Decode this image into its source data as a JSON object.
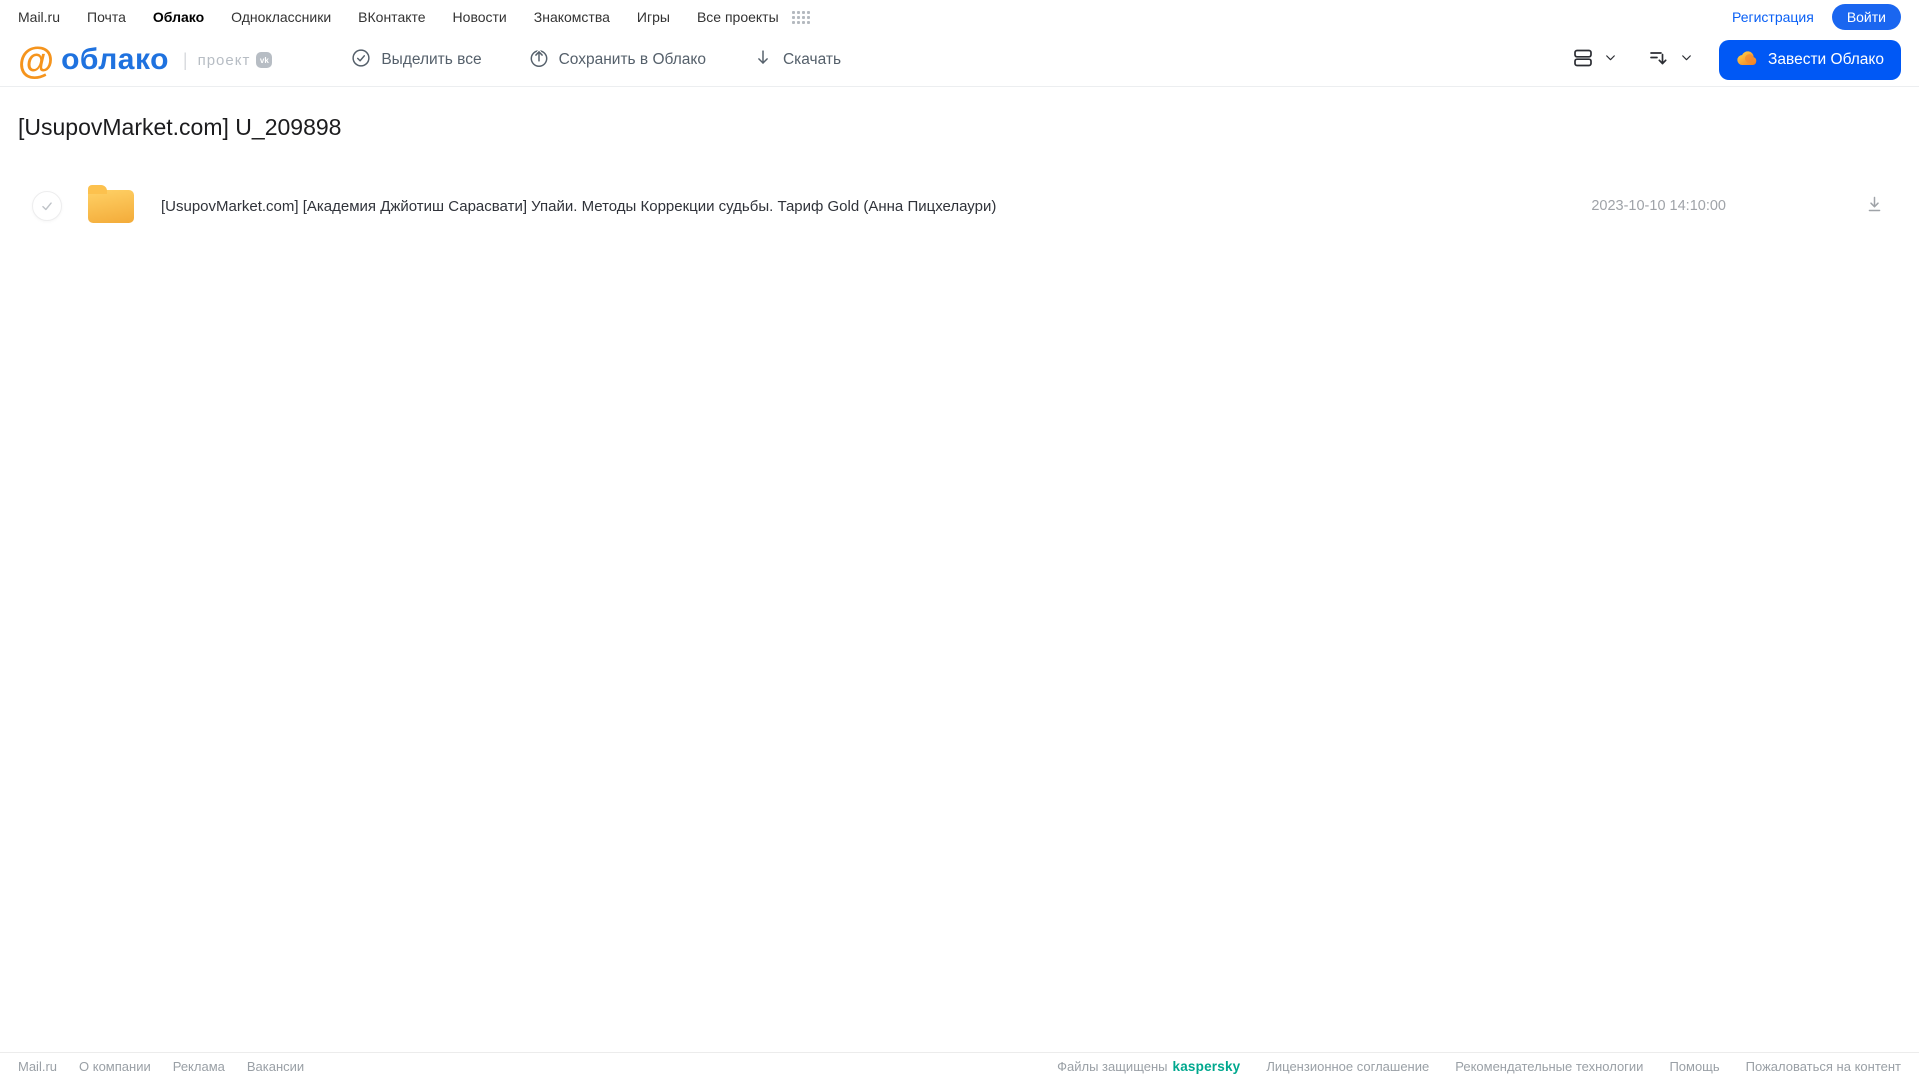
{
  "top_nav": {
    "items": [
      {
        "label": "Mail.ru"
      },
      {
        "label": "Почта"
      },
      {
        "label": "Облако",
        "active": true
      },
      {
        "label": "Одноклассники"
      },
      {
        "label": "ВКонтакте"
      },
      {
        "label": "Новости"
      },
      {
        "label": "Знакомства"
      },
      {
        "label": "Игры"
      },
      {
        "label": "Все проекты"
      }
    ],
    "register_label": "Регистрация",
    "login_label": "Войти"
  },
  "header": {
    "logo_at": "@",
    "logo_text": "облако",
    "project_label": "проект",
    "vk_badge": "vk",
    "toolbar": {
      "select_all": "Выделить все",
      "save_to_cloud": "Сохранить в Облако",
      "download": "Скачать"
    },
    "create_cloud_label": "Завести Облако"
  },
  "page": {
    "title": "[UsupovMarket.com] U_209898"
  },
  "files": [
    {
      "name": "[UsupovMarket.com] [Академия Джйотиш Сарасвати] Упайи. Методы Коррекции судьбы. Тариф Gold (Анна Пицхелаури)",
      "modified": "2023-10-10 14:10:00",
      "type": "folder"
    }
  ],
  "footer": {
    "left_links": [
      "Mail.ru",
      "О компании",
      "Реклама",
      "Вакансии"
    ],
    "protected_prefix": "Файлы защищены",
    "antivirus_brand": "kaspersky",
    "right_links": [
      "Лицензионное соглашение",
      "Рекомендательные технологии",
      "Помощь",
      "Пожаловаться на контент"
    ]
  },
  "colors": {
    "accent_blue": "#0058f5",
    "login_blue": "#1a66f0",
    "logo_blue": "#1f72df",
    "logo_orange": "#f5941d",
    "kaspersky_green": "#00a88e",
    "folder_top": "#ffd166",
    "folder_bottom": "#f3ab39"
  }
}
